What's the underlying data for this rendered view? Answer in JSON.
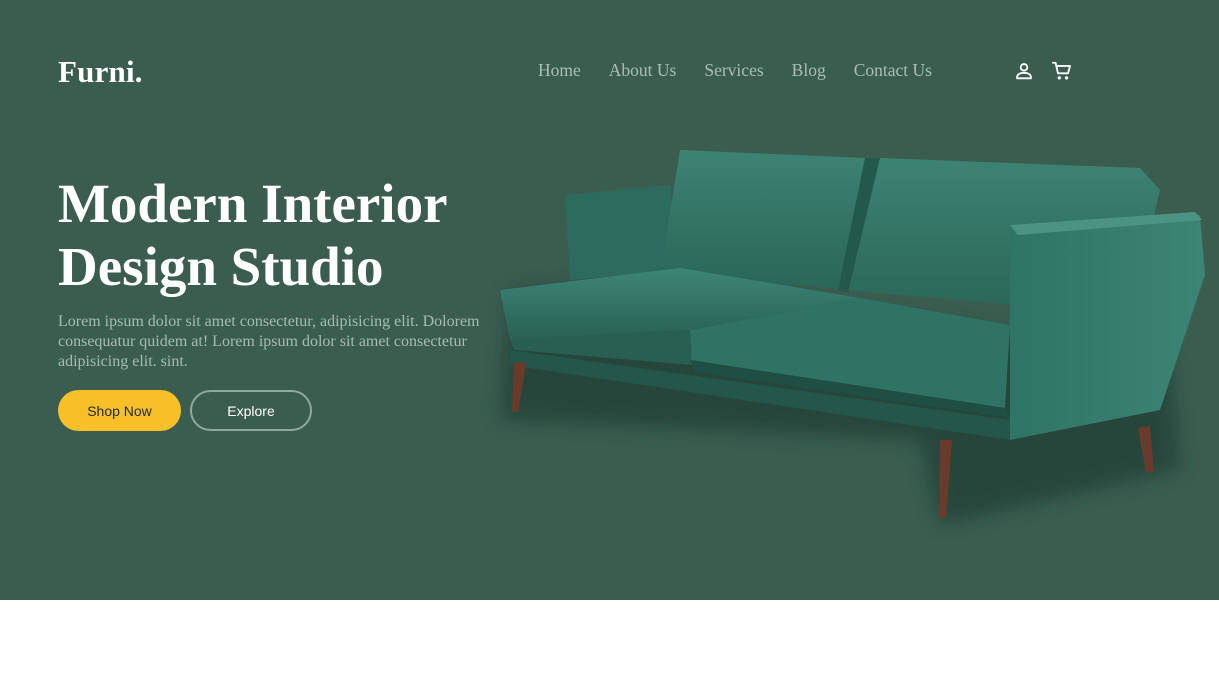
{
  "header": {
    "logo": "Furni.",
    "nav": [
      "Home",
      "About Us",
      "Services",
      "Blog",
      "Contact Us"
    ],
    "icons": [
      "user-icon",
      "cart-icon"
    ]
  },
  "hero": {
    "title_line1": "Modern Interior",
    "title_line2": "Design Studio",
    "description": "Lorem ipsum dolor sit amet consectetur, adipisicing elit. Dolorem consequatur quidem at! Lorem ipsum dolor sit amet consectetur adipisicing elit. sint.",
    "primary_button": "Shop Now",
    "secondary_button": "Explore"
  },
  "colors": {
    "hero_bg": "#3b5d50",
    "accent": "#f9bf29",
    "nav_text": "#a9bfb6",
    "sofa": "#2f7364"
  }
}
